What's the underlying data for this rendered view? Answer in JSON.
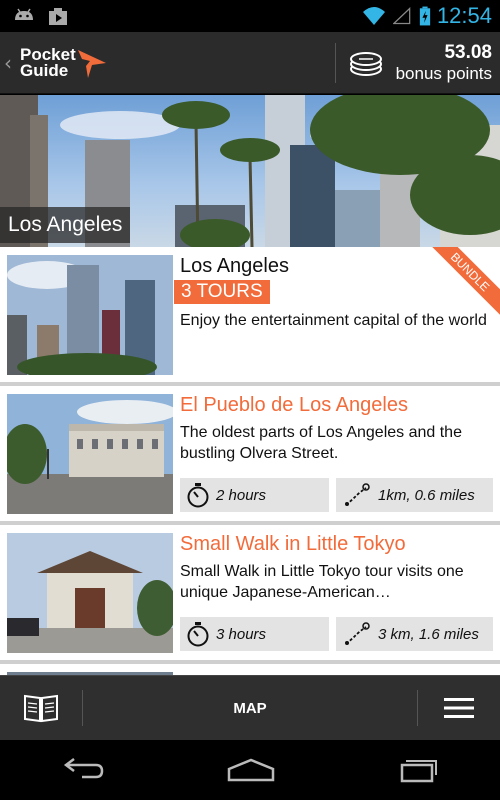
{
  "status_bar": {
    "time": "12:54"
  },
  "header": {
    "logo_line1": "Pocket",
    "logo_line2": "Guide",
    "points_value": "53.08",
    "points_label": "bonus points"
  },
  "hero": {
    "title": "Los Angeles"
  },
  "cards": [
    {
      "title": "Los Angeles",
      "badge": "3 TOURS",
      "ribbon": "BUNDLE",
      "description": "Enjoy the entertainment capital of the world"
    },
    {
      "title": "El Pueblo de Los Angeles",
      "description": "The oldest parts of Los Angeles and the bustling Olvera Street.",
      "duration": "2 hours",
      "distance": "1km, 0.6 miles"
    },
    {
      "title": "Small Walk in Little Tokyo",
      "description": "Small Walk in Little Tokyo tour visits one unique Japanese-American…",
      "duration": "3 hours",
      "distance": "3 km, 1.6 miles"
    }
  ],
  "toolbar": {
    "map_label": "MAP"
  },
  "colors": {
    "accent": "#f26b3a",
    "status_blue": "#33b5e5"
  },
  "icons": [
    "android-icon",
    "play-store-icon",
    "wifi-icon",
    "signal-icon",
    "battery-icon",
    "coin-stack-icon",
    "book-icon",
    "menu-icon",
    "stopwatch-icon",
    "route-icon",
    "back-icon",
    "home-icon",
    "recent-apps-icon"
  ]
}
